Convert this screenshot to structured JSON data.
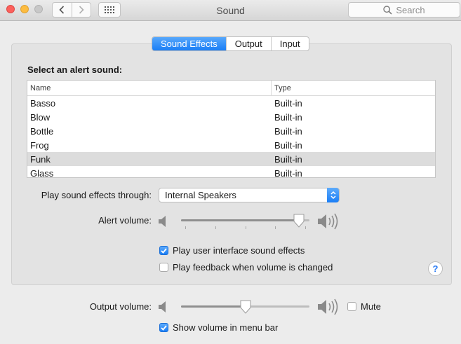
{
  "window": {
    "title": "Sound"
  },
  "search": {
    "placeholder": "Search"
  },
  "tabs": [
    {
      "label": "Sound Effects",
      "active": true
    },
    {
      "label": "Output",
      "active": false
    },
    {
      "label": "Input",
      "active": false
    }
  ],
  "alerts": {
    "title": "Select an alert sound:",
    "columns": [
      "Name",
      "Type"
    ],
    "rows": [
      {
        "name": "Basso",
        "type": "Built-in",
        "selected": false
      },
      {
        "name": "Blow",
        "type": "Built-in",
        "selected": false
      },
      {
        "name": "Bottle",
        "type": "Built-in",
        "selected": false
      },
      {
        "name": "Frog",
        "type": "Built-in",
        "selected": false
      },
      {
        "name": "Funk",
        "type": "Built-in",
        "selected": true
      },
      {
        "name": "Glass",
        "type": "Built-in",
        "selected": false
      }
    ]
  },
  "play_through": {
    "label": "Play sound effects through:",
    "value": "Internal Speakers"
  },
  "alert_volume": {
    "label": "Alert volume:",
    "level": 0.95
  },
  "options": {
    "ui_sounds": {
      "label": "Play user interface sound effects",
      "checked": true
    },
    "feedback": {
      "label": "Play feedback when volume is changed",
      "checked": false
    }
  },
  "output_volume": {
    "label": "Output volume:",
    "level": 0.5
  },
  "mute": {
    "label": "Mute",
    "checked": false
  },
  "menubar": {
    "label": "Show volume in menu bar",
    "checked": true
  },
  "help": {
    "label": "?"
  },
  "colors": {
    "accent": "#1a7ef6",
    "close": "#fc605c",
    "minimize": "#fdbc40"
  }
}
